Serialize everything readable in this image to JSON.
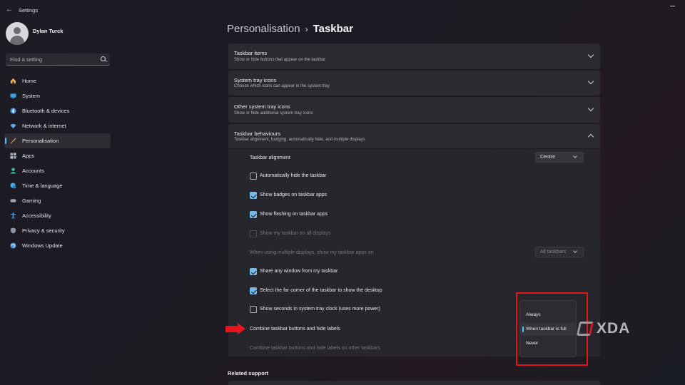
{
  "app": {
    "title": "Settings"
  },
  "user": {
    "name": "Dylan Turck"
  },
  "search": {
    "placeholder": "Find a setting"
  },
  "sidebar": {
    "items": [
      {
        "label": "Home",
        "icon": "home-icon",
        "color": "#e8b04a"
      },
      {
        "label": "System",
        "icon": "monitor-icon",
        "color": "#3aa0e8"
      },
      {
        "label": "Bluetooth & devices",
        "icon": "bluetooth-icon",
        "color": "#3a8ee8"
      },
      {
        "label": "Network & internet",
        "icon": "wifi-icon",
        "color": "#5ab0f0"
      },
      {
        "label": "Personalisation",
        "icon": "brush-icon",
        "color": "#e89a4a",
        "active": true
      },
      {
        "label": "Apps",
        "icon": "apps-icon",
        "color": "#9aa4b4"
      },
      {
        "label": "Accounts",
        "icon": "person-icon",
        "color": "#3ac0a0"
      },
      {
        "label": "Time & language",
        "icon": "globe-clock-icon",
        "color": "#4aa8e8"
      },
      {
        "label": "Gaming",
        "icon": "gamepad-icon",
        "color": "#9aa4b4"
      },
      {
        "label": "Accessibility",
        "icon": "accessibility-icon",
        "color": "#4aa0f0"
      },
      {
        "label": "Privacy & security",
        "icon": "shield-icon",
        "color": "#8a94a4"
      },
      {
        "label": "Windows Update",
        "icon": "update-icon",
        "color": "#3a9ae8"
      }
    ]
  },
  "breadcrumb": {
    "parent": "Personalisation",
    "separator": "›",
    "current": "Taskbar"
  },
  "sections": [
    {
      "title": "Taskbar items",
      "desc": "Show or hide buttons that appear on the taskbar",
      "expanded": false
    },
    {
      "title": "System tray icons",
      "desc": "Choose which icons can appear in the system tray",
      "expanded": false
    },
    {
      "title": "Other system tray icons",
      "desc": "Show or hide additional system tray icons",
      "expanded": false
    },
    {
      "title": "Taskbar behaviours",
      "desc": "Taskbar alignment, badging, automatically hide, and multiple displays",
      "expanded": true
    }
  ],
  "behaviours": {
    "alignment": {
      "label": "Taskbar alignment",
      "value": "Centre"
    },
    "auto_hide": {
      "label": "Automatically hide the taskbar",
      "checked": false
    },
    "badges": {
      "label": "Show badges on taskbar apps",
      "checked": true
    },
    "flashing": {
      "label": "Show flashing on taskbar apps",
      "checked": true
    },
    "all_displays": {
      "label": "Show my taskbar on all displays",
      "checked": false,
      "disabled": true
    },
    "multi_display": {
      "label": "When using multiple displays, show my taskbar apps on",
      "value": "All taskbars",
      "disabled": true
    },
    "share_window": {
      "label": "Share any window from my taskbar",
      "checked": true
    },
    "far_corner": {
      "label": "Select the far corner of the taskbar to show the desktop",
      "checked": true
    },
    "seconds": {
      "label": "Show seconds in system tray clock (uses more power)",
      "checked": false
    },
    "combine": {
      "label": "Combine taskbar buttons and hide labels"
    },
    "combine_other": {
      "label": "Combine taskbar buttons and hide labels on other taskbars",
      "disabled": true
    }
  },
  "combine_menu": {
    "options": [
      "Always",
      "When taskbar is full",
      "Never"
    ],
    "selected": "When taskbar is full"
  },
  "annotation": {
    "highlight_color": "#e0141a",
    "arrow_color": "#e8161c"
  },
  "watermark": {
    "text": "XDA"
  },
  "related": {
    "heading": "Related support"
  }
}
